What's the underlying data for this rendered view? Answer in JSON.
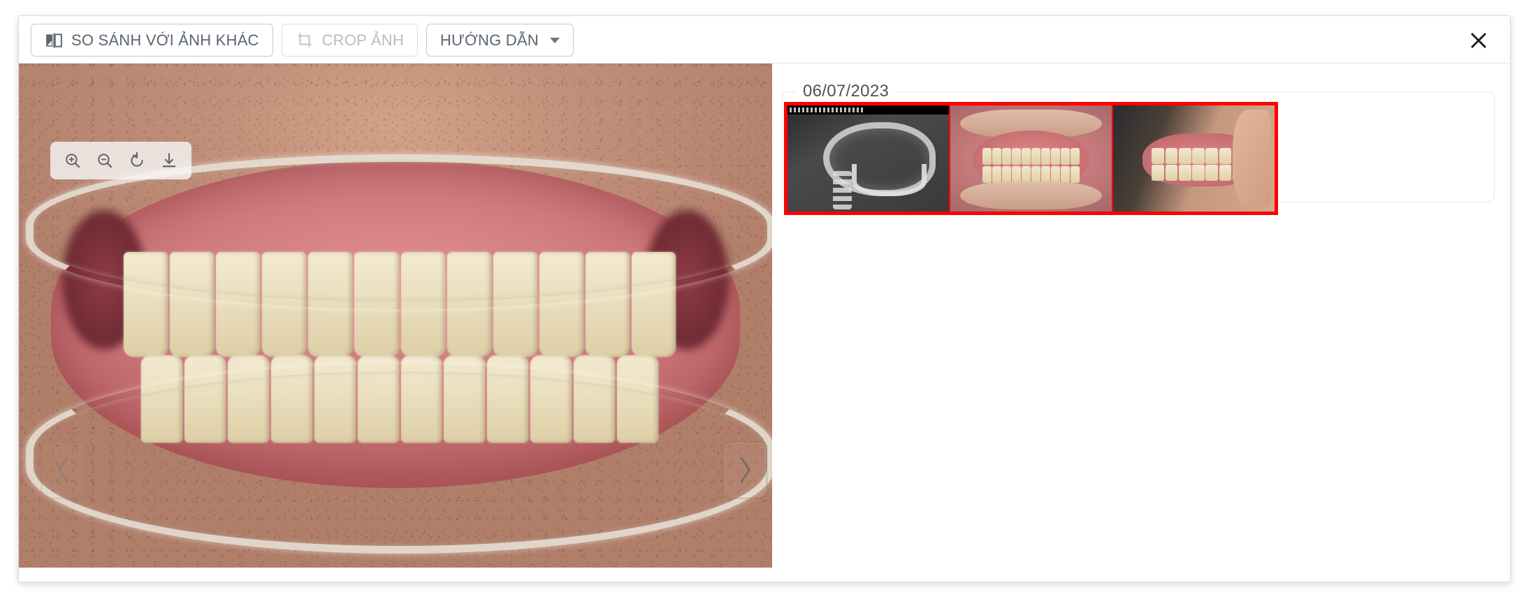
{
  "window": {
    "close_label": "✕"
  },
  "toolbar": {
    "compare_label": "SO SÁNH VỚI ẢNH KHÁC",
    "compare_icon": "compare-images-icon",
    "crop_label": "CROP ẢNH",
    "crop_icon": "crop-icon",
    "crop_disabled": true,
    "guide_label": "HƯỚNG DẪN",
    "guide_caret": "▾"
  },
  "image_tools": [
    {
      "name": "zoom-in-icon",
      "title": "Phóng to"
    },
    {
      "name": "zoom-out-icon",
      "title": "Thu nhỏ"
    },
    {
      "name": "rotate-icon",
      "title": "Xoay ảnh"
    },
    {
      "name": "download-icon",
      "title": "Tải ảnh"
    }
  ],
  "viewer": {
    "prev_label": "‹",
    "next_label": "›",
    "main_image_alt": "Ảnh trong miệng mặt trước"
  },
  "thumbnails": {
    "date": "06/07/2023",
    "selected": true,
    "selection_color": "#ff0000",
    "items": [
      {
        "type": "xray",
        "alt": "Phim sọ nghiêng"
      },
      {
        "type": "front",
        "alt": "Ảnh trong miệng mặt trước"
      },
      {
        "type": "side",
        "alt": "Ảnh trong miệng mặt bên"
      }
    ]
  }
}
